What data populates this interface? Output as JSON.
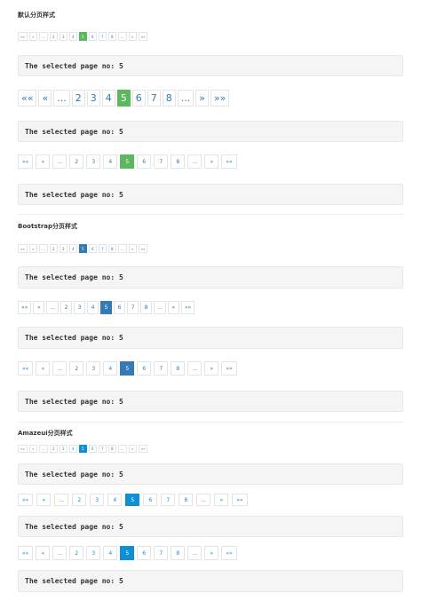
{
  "sections": {
    "default_title": "默认分页样式",
    "bootstrap_title": "Bootstrap分页样式",
    "amazeui_title": "Amazeui分页样式"
  },
  "pager_items": [
    "««",
    "«",
    "...",
    "2",
    "3",
    "4",
    "5",
    "6",
    "7",
    "8",
    "...",
    "»",
    "»»"
  ],
  "active_page": "5",
  "result_text": "The selected page no: 5",
  "colors": {
    "default_active": "#5cb85c",
    "bootstrap_active": "#337ab7",
    "amazeui_active": "#0e90d2",
    "link_blue": "#337ab7",
    "amaze_link": "#0e90d2",
    "result_bg": "#f5f5f5"
  }
}
